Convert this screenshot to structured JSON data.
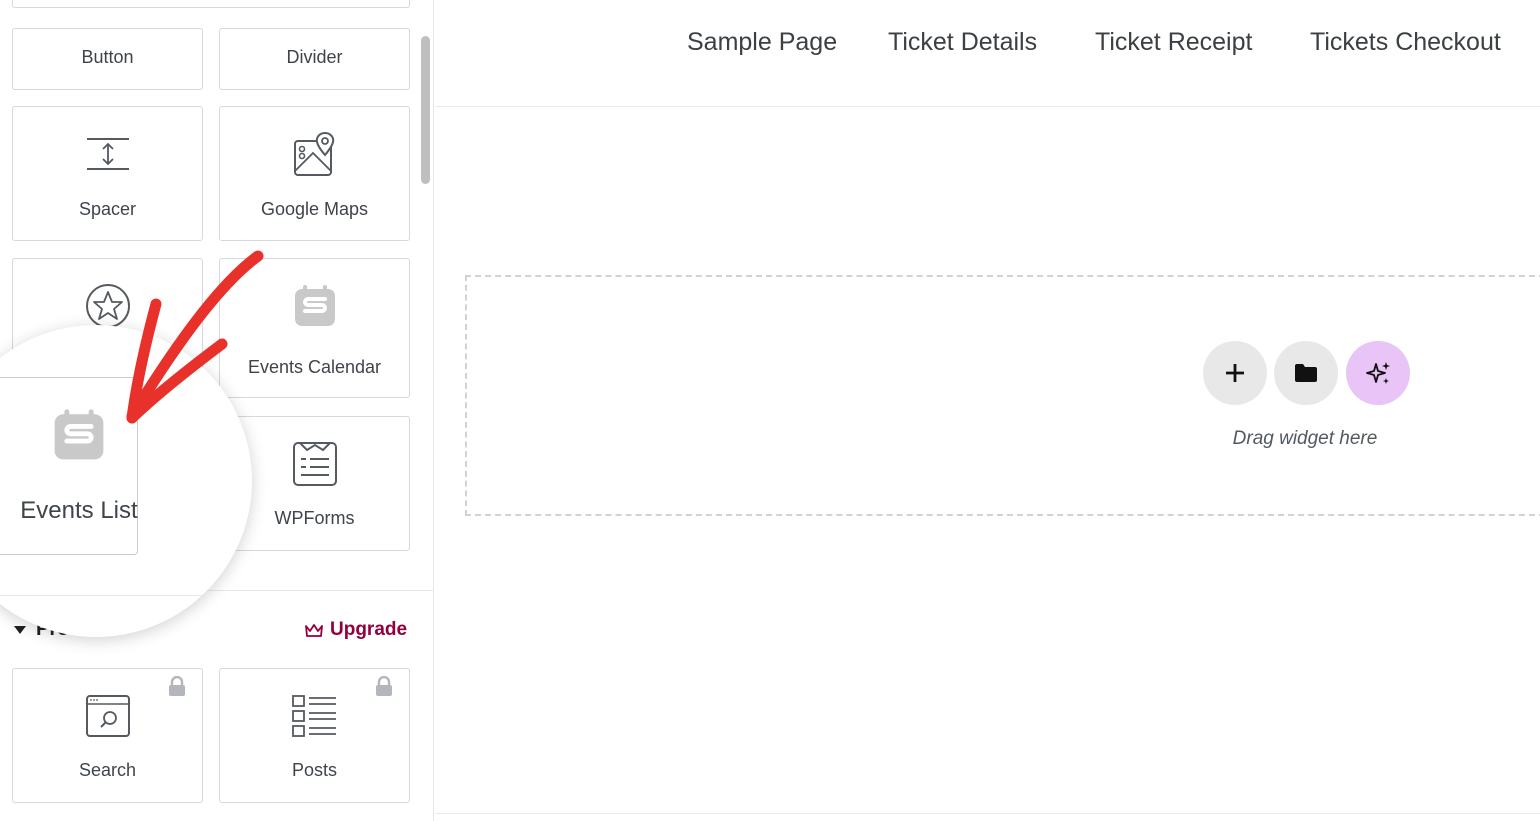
{
  "panel": {
    "widgets": [
      {
        "label": "Button",
        "icon": "button-icon"
      },
      {
        "label": "Divider",
        "icon": "divider-icon"
      },
      {
        "label": "Spacer",
        "icon": "spacer-icon"
      },
      {
        "label": "Google Maps",
        "icon": "map-icon"
      },
      {
        "label": "",
        "icon": "star-icon"
      },
      {
        "label": "Events Calendar",
        "icon": "events-calendar-icon"
      },
      {
        "label": "Events List",
        "icon": "events-list-icon"
      },
      {
        "label": "WPForms",
        "icon": "wpforms-icon"
      }
    ],
    "pro_section": {
      "title": "Pro",
      "upgrade_label": "Upgrade",
      "widgets": [
        {
          "label": "Search",
          "icon": "search-icon",
          "locked": true
        },
        {
          "label": "Posts",
          "icon": "posts-icon",
          "locked": true
        }
      ]
    }
  },
  "canvas": {
    "nav": [
      "Sample Page",
      "Ticket Details",
      "Ticket Receipt",
      "Tickets Checkout"
    ],
    "dropzone_text": "Drag widget here"
  },
  "colors": {
    "upgrade": "#93003f",
    "ai_button": "#e8c4f7",
    "neutral_button": "#e8e8e8",
    "annotation_arrow": "#e8312a"
  }
}
